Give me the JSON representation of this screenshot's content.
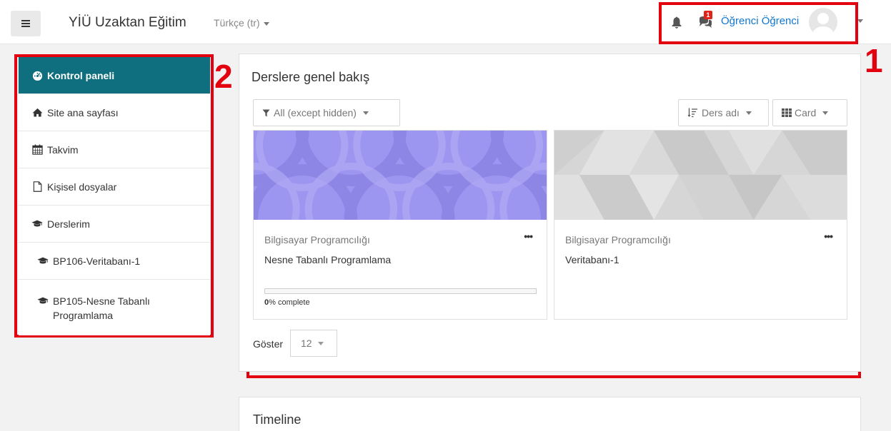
{
  "navbar": {
    "site_name": "YİÜ Uzaktan Eğitim",
    "language": "Türkçe (tr)",
    "messages_badge": "1",
    "user_name": "Öğrenci Öğrenci"
  },
  "annotations": {
    "box1": "1",
    "box2": "2"
  },
  "sidebar": {
    "items": [
      {
        "label": "Kontrol paneli",
        "icon": "dashboard-icon"
      },
      {
        "label": "Site ana sayfası",
        "icon": "home-icon"
      },
      {
        "label": "Takvim",
        "icon": "calendar-icon"
      },
      {
        "label": "Kişisel dosyalar",
        "icon": "file-icon"
      },
      {
        "label": "Derslerim",
        "icon": "graduation-cap-icon"
      },
      {
        "label": "BP106-Veritabanı-1",
        "icon": "graduation-cap-icon"
      },
      {
        "label": "BP105-Nesne Tabanlı Programlama",
        "icon": "graduation-cap-icon"
      }
    ]
  },
  "overview": {
    "title": "Derslere genel bakış",
    "filter_label": "All (except hidden)",
    "sort_label": "Ders adı",
    "view_label": "Card",
    "courses": [
      {
        "category": "Bilgisayar Programcılığı",
        "name": "Nesne Tabanlı Programlama",
        "progress_bold": "0",
        "progress_text": "% complete",
        "progress_value": 0,
        "image_color": "#9f98f0"
      },
      {
        "category": "Bilgisayar Programcılığı",
        "name": "Veritabanı-1",
        "image_color": "#d4d4d4"
      }
    ],
    "show_label": "Göster",
    "show_value": "12"
  },
  "timeline": {
    "title": "Timeline"
  },
  "colors": {
    "accent": "#0f6f7f",
    "link": "#1177d1",
    "annotation": "#e3000f",
    "badge": "#e2231a"
  }
}
